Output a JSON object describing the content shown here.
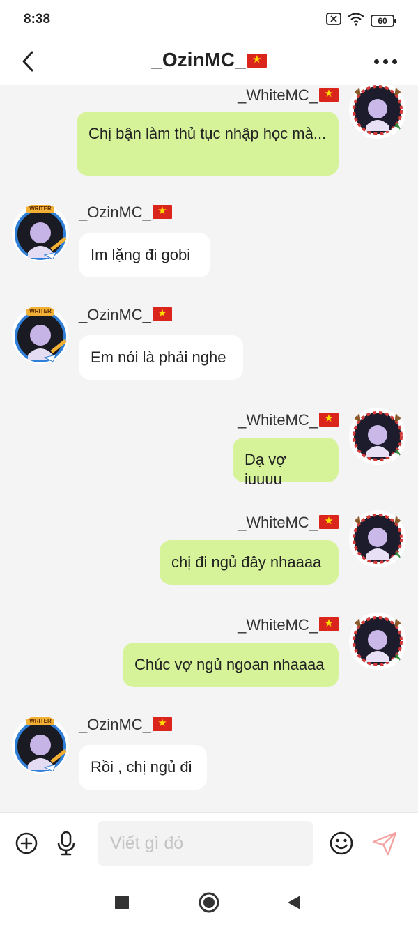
{
  "status_bar": {
    "time": "8:38",
    "battery": "60",
    "icons": [
      "sim-off-icon",
      "wifi-icon",
      "battery-icon"
    ]
  },
  "header": {
    "title": "_OzinMC_",
    "back_icon": "chevron-left-icon",
    "more_icon": "more-horizontal-icon"
  },
  "messages": [
    {
      "sender": "_WhiteMC_",
      "direction": "outgoing",
      "text": "Chị bận làm thủ tục nhập học mà..."
    },
    {
      "sender": "_OzinMC_",
      "direction": "incoming",
      "text": "Im lặng đi gobi"
    },
    {
      "sender": "_OzinMC_",
      "direction": "incoming",
      "text": "Em nói là phải nghe"
    },
    {
      "sender": "_WhiteMC_",
      "direction": "outgoing",
      "text": "Dạ vợ iuuuu"
    },
    {
      "sender": "_WhiteMC_",
      "direction": "outgoing",
      "text": "chị đi ngủ đây nhaaaa"
    },
    {
      "sender": "_WhiteMC_",
      "direction": "outgoing",
      "text": "Chúc vợ ngủ ngoan nhaaaa"
    },
    {
      "sender": "_OzinMC_",
      "direction": "incoming",
      "text": "Rồi , chị ngủ đi"
    }
  ],
  "avatar_badge": "WRITER",
  "input_bar": {
    "placeholder": "Viết gì đó",
    "value": "",
    "icons": [
      "add-circle-icon",
      "microphone-icon",
      "emoji-icon",
      "send-icon"
    ]
  },
  "nav_bar": {
    "icons": [
      "recents-square-icon",
      "home-circle-icon",
      "back-triangle-icon"
    ]
  },
  "colors": {
    "outgoing_bubble": "#d6f39a",
    "incoming_bubble": "#ffffff",
    "chat_background": "#f4f4f4",
    "send_icon": "#f4a3a3",
    "flag_red": "#da251d",
    "flag_star": "#ffde00"
  }
}
